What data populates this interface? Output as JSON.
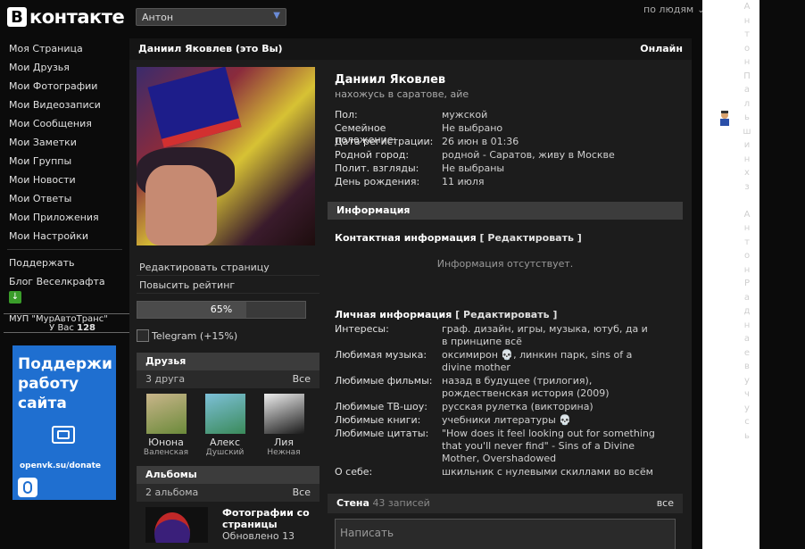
{
  "header": {
    "logo_letter": "В",
    "logo_text": "контакте",
    "user_select": "Антон",
    "search_scope": "по людям"
  },
  "nav": {
    "items": [
      "Моя Страница",
      "Мои Друзья",
      "Мои Фотографии",
      "Мои Видеозаписи",
      "Мои Сообщения",
      "Мои Заметки",
      "Мои Группы",
      "Мои Новости",
      "Мои Ответы",
      "Мои Приложения",
      "Мои Настройки"
    ],
    "extra": [
      "Поддержать",
      "Блог Веселкрафта"
    ]
  },
  "org": {
    "name": "МУП \"МурАвтоТранс\"",
    "count_prefix": "У Вас",
    "count": "128"
  },
  "donate": {
    "title_lines": [
      "Поддержи",
      "работу",
      "сайта"
    ],
    "url": "openvk.su/donate"
  },
  "profile": {
    "header_title": "Даниил Яковлев (это Вы)",
    "online": "Онлайн",
    "name": "Даниил Яковлев",
    "status": "нахожусь в саратове, айе",
    "info": [
      {
        "label": "Пол:",
        "value": "мужской"
      },
      {
        "label": "Семейное положение:",
        "value": "Не выбрано"
      },
      {
        "label": "Дата регистрации:",
        "value": "26 июн в 01:36"
      },
      {
        "label": "Родной город:",
        "value": "родной - Саратов, живу в Москве"
      },
      {
        "label": "Полит. взгляды:",
        "value": "Не выбраны"
      },
      {
        "label": "День рождения:",
        "value": "11 июля"
      }
    ],
    "edit_page": "Редактировать страницу",
    "boost_rating": "Повысить рейтинг",
    "rating_percent": "65%",
    "rating_value": 0.65,
    "telegram": "Telegram (+15%)"
  },
  "friends": {
    "title": "Друзья",
    "count": "3 друга",
    "all": "Все",
    "list": [
      {
        "name": "Юнона",
        "city": "Валенская"
      },
      {
        "name": "Алекс",
        "city": "Душский"
      },
      {
        "name": "Лия",
        "city": "Нежная"
      }
    ]
  },
  "albums": {
    "title": "Альбомы",
    "count": "2 альбома",
    "all": "Все",
    "album_title_1": "Фотографии со",
    "album_title_2": "страницы",
    "album_meta": "Обновлено 13"
  },
  "info_section": {
    "title": "Информация",
    "contact_title": "Контактная информация",
    "edit_label": "[ Редактировать ]",
    "empty": "Информация отсутствует.",
    "personal_title": "Личная информация",
    "personal": [
      {
        "label": "Интересы:",
        "value": "граф. дизайн, игры, музыка, ютуб, да и в принципе всё"
      },
      {
        "label": "Любимая музыка:",
        "value": "оксимирон 💀, линкин парк, sins of a divine mother"
      },
      {
        "label": "Любимые фильмы:",
        "value": "назад в будущее (трилогия), рождественская история (2009)"
      },
      {
        "label": "Любимые ТВ-шоу:",
        "value": "русская рулетка (викторина)"
      },
      {
        "label": "Любимые книги:",
        "value": "учебники литературы 💀"
      },
      {
        "label": "Любимые цитаты:",
        "value": "\"How does it feel looking out for something that you'll never find\" - Sins of a Divine Mother, Overshadowed"
      },
      {
        "label": "О себе:",
        "value": "шкильник с нулевыми скиллами во всём"
      }
    ]
  },
  "wall": {
    "title": "Стена",
    "count": "43 записей",
    "all": "все",
    "placeholder": "Написать"
  },
  "online_strip": {
    "letters": [
      "А",
      "н",
      "т",
      "о",
      "н",
      "П",
      "а",
      "л",
      "ь",
      "ш",
      "и",
      "н",
      "х",
      "з",
      "",
      "А",
      "н",
      "т",
      "о",
      "н",
      "Р",
      "а",
      "д",
      "н",
      "а",
      "е",
      "в",
      "у",
      "ч",
      "у",
      "с",
      "ь"
    ]
  }
}
